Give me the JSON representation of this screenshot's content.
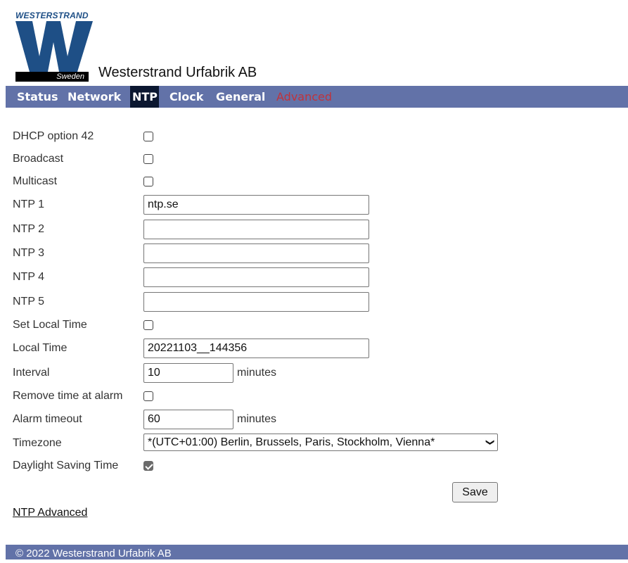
{
  "header": {
    "brand_text": "WESTERSTRAND",
    "logo_country": "Sweden",
    "company": "Westerstrand Urfabrik AB"
  },
  "nav": {
    "items": [
      {
        "label": "Status"
      },
      {
        "label": "Network"
      },
      {
        "label": "NTP",
        "active": true
      },
      {
        "label": "Clock"
      },
      {
        "label": "General"
      },
      {
        "label": "Advanced"
      }
    ]
  },
  "colors": {
    "nav_bg": "#6272a8",
    "nav_active_bg": "#0b1730",
    "advanced_text": "#c0333b",
    "logo_blue": "#1e4f86"
  },
  "form": {
    "dhcp_option42": {
      "label": "DHCP option 42",
      "checked": false
    },
    "broadcast": {
      "label": "Broadcast",
      "checked": false
    },
    "multicast": {
      "label": "Multicast",
      "checked": false
    },
    "ntp1": {
      "label": "NTP 1",
      "value": "ntp.se"
    },
    "ntp2": {
      "label": "NTP 2",
      "value": ""
    },
    "ntp3": {
      "label": "NTP 3",
      "value": ""
    },
    "ntp4": {
      "label": "NTP 4",
      "value": ""
    },
    "ntp5": {
      "label": "NTP 5",
      "value": ""
    },
    "set_local_time": {
      "label": "Set Local Time",
      "checked": false
    },
    "local_time": {
      "label": "Local Time",
      "value": "20221103__144356"
    },
    "interval": {
      "label": "Interval",
      "value": "10",
      "unit": "minutes"
    },
    "remove_time_at_alarm": {
      "label": "Remove time at alarm",
      "checked": false
    },
    "alarm_timeout": {
      "label": "Alarm timeout",
      "value": "60",
      "unit": "minutes"
    },
    "timezone": {
      "label": "Timezone",
      "selected": "*(UTC+01:00) Berlin, Brussels, Paris, Stockholm, Vienna*"
    },
    "daylight_saving_time": {
      "label": "Daylight Saving Time",
      "checked": true
    },
    "save_label": "Save"
  },
  "links": {
    "ntp_advanced": "NTP Advanced"
  },
  "footer": {
    "copyright": "© 2022 Westerstrand Urfabrik AB"
  }
}
